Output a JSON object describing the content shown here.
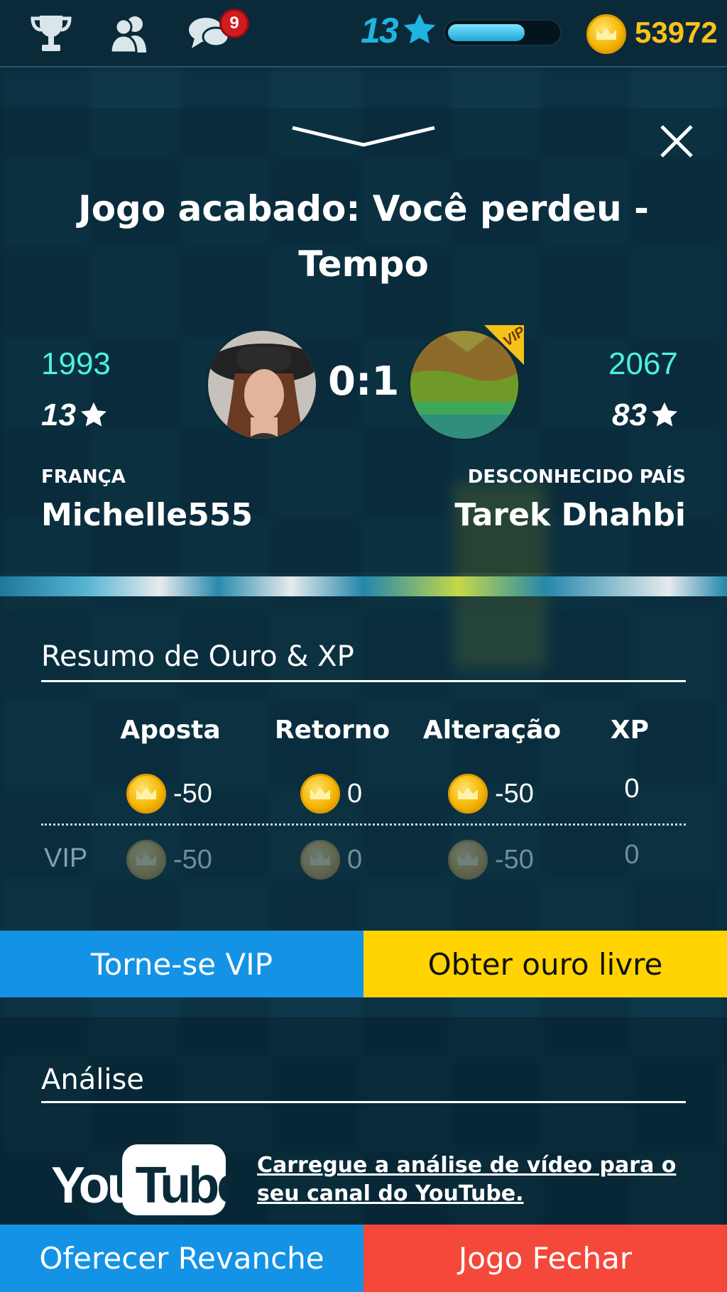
{
  "topbar": {
    "notification_count": "9",
    "level": "13",
    "xp_progress": 0.7,
    "gold": "53972"
  },
  "result": {
    "title": "Jogo acabado: Você perdeu - Tempo",
    "score": "0:1"
  },
  "player_left": {
    "rating": "1993",
    "stars": "13",
    "country": "FRANÇA",
    "name": "Michelle555"
  },
  "player_right": {
    "rating": "2067",
    "stars": "83",
    "country": "DESCONHECIDO PAÍS",
    "name": "Tarek Dhahbi",
    "vip_badge": "VIP"
  },
  "summary": {
    "title": "Resumo de Ouro & XP",
    "columns": [
      "Aposta",
      "Retorno",
      "Alteração",
      "XP"
    ],
    "row": [
      "-50",
      "0",
      "-50",
      "0"
    ],
    "vip_label": "VIP",
    "vip_row": [
      "-50",
      "0",
      "-50",
      "0"
    ]
  },
  "buttons": {
    "vip": "Torne-se VIP",
    "free_gold": "Obter ouro livre",
    "rematch": "Oferecer Revanche",
    "close_game": "Jogo Fechar"
  },
  "analysis": {
    "title": "Análise",
    "youtube_logo": "YouTube",
    "link": "Carregue a análise de vídeo para o seu canal do YouTube."
  },
  "colors": {
    "rating": "#4ef0e0",
    "gold": "#fcc21b",
    "vip_button": "#1493e6",
    "free_gold_button": "#ffd400",
    "close_button": "#f4483a"
  }
}
